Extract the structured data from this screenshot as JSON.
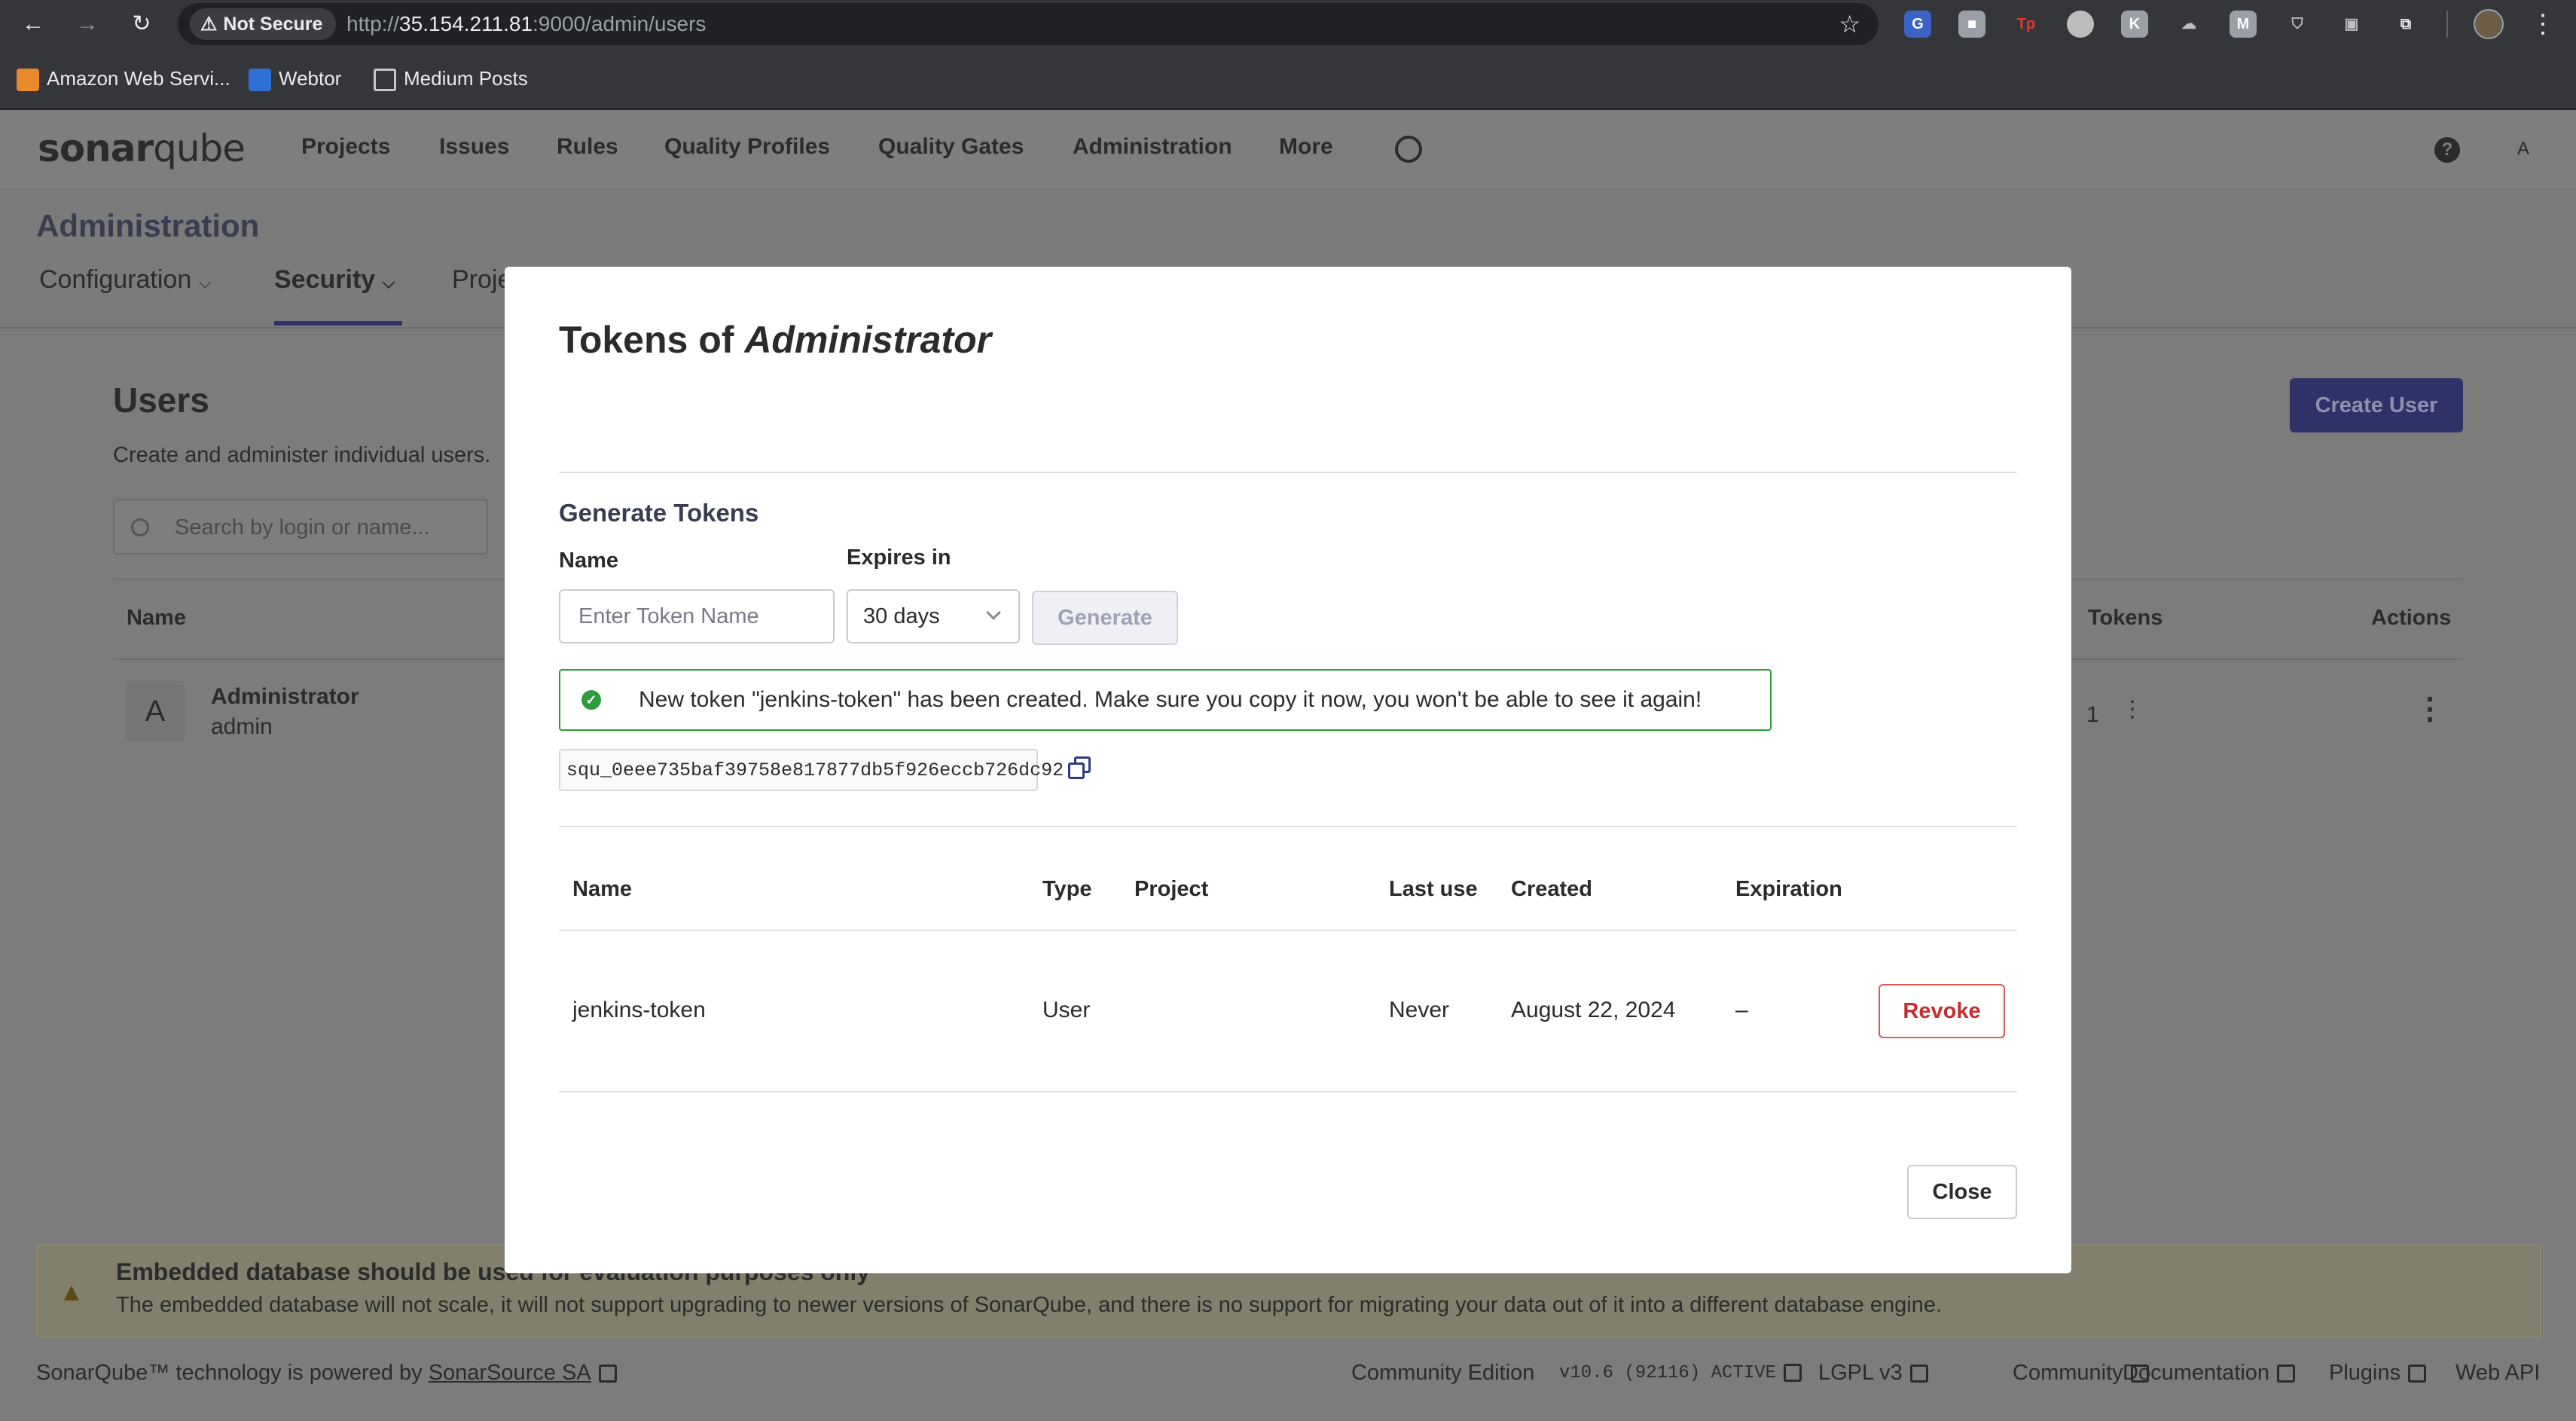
{
  "browser": {
    "security_label": "Not Secure",
    "url_prefix": "http://",
    "url_host": "35.154.211.81",
    "url_rest": ":9000/admin/users",
    "bookmarks": [
      "Amazon Web Servi...",
      "Webtor",
      "Medium Posts"
    ]
  },
  "app": {
    "logo_a": "sonar",
    "logo_b": "qube",
    "nav": [
      "Projects",
      "Issues",
      "Rules",
      "Quality Profiles",
      "Quality Gates",
      "Administration",
      "More"
    ],
    "user_initial": "A"
  },
  "admin": {
    "title": "Administration",
    "tabs": [
      "Configuration",
      "Security",
      "Proje"
    ]
  },
  "users_page": {
    "title": "Users",
    "subtitle": "Create and administer individual users.",
    "create_button": "Create User",
    "search_placeholder": "Search by login or name...",
    "columns": {
      "name": "Name",
      "tokens": "Tokens",
      "actions": "Actions"
    },
    "row": {
      "initial": "A",
      "name": "Administrator",
      "login": "admin",
      "tokens": "1"
    }
  },
  "warning": {
    "title": "Embedded database should be used for evaluation purposes only",
    "text": "The embedded database will not scale, it will not support upgrading to newer versions of SonarQube, and there is no support for migrating your data out of it into a different database engine."
  },
  "footer": {
    "powered_text": "SonarQube™ technology is powered by",
    "powered_link": "SonarSource SA",
    "edition": "Community Edition",
    "version": "v10.6 (92116) ACTIVE",
    "license": "LGPL v3",
    "community": "Community",
    "documentation": "Documentation",
    "plugins": "Plugins",
    "webapi": "Web API"
  },
  "modal": {
    "title_prefix": "Tokens of",
    "title_user": "Administrator",
    "generate_title": "Generate Tokens",
    "name_label": "Name",
    "name_placeholder": "Enter Token Name",
    "expires_label": "Expires in",
    "expires_value": "30 days",
    "generate_button": "Generate",
    "success_message": "New token \"jenkins-token\" has been created. Make sure you copy it now, you won't be able to see it again!",
    "token_value": "squ_0eee735baf39758e817877db5f926eccb726dc92",
    "table": {
      "headers": [
        "Name",
        "Type",
        "Project",
        "Last use",
        "Created",
        "Expiration"
      ],
      "row": {
        "name": "jenkins-token",
        "type": "User",
        "project": "",
        "last_use": "Never",
        "created": "August 22, 2024",
        "expiration": "–"
      },
      "revoke_button": "Revoke"
    },
    "close_button": "Close"
  },
  "colors": {
    "accent": "#2e3266",
    "success": "#2d9c3c",
    "danger": "#c42d2d"
  }
}
